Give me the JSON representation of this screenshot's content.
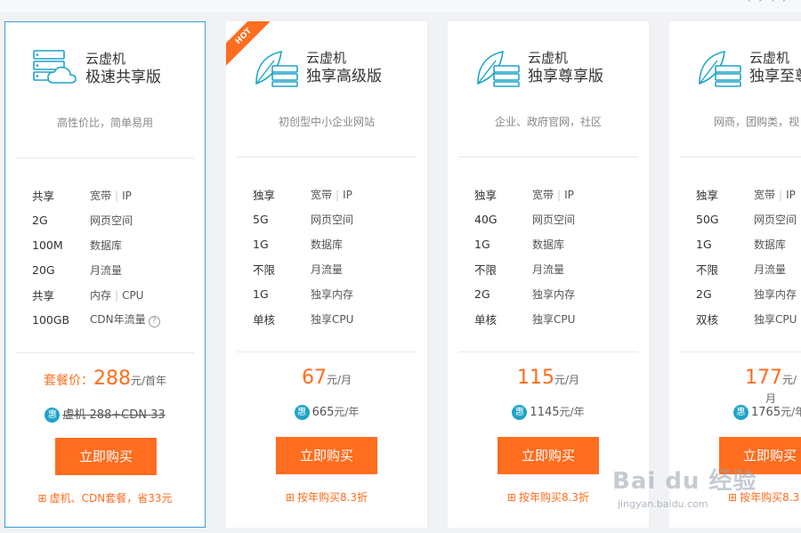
{
  "cards": [
    {
      "title1": "云虚机",
      "title2": "极速共享版",
      "subtitle": "高性价比，简单易用",
      "hot": "",
      "specs": [
        {
          "value": "共享",
          "label": "宽带",
          "label2": "IP"
        },
        {
          "value": "2G",
          "label": "网页空间"
        },
        {
          "value": "100M",
          "label": "数据库"
        },
        {
          "value": "20G",
          "label": "月流量"
        },
        {
          "value": "共享",
          "label": "内存",
          "label2": "CPU"
        },
        {
          "value": "100GB",
          "label": "CDN年流量",
          "help": "?"
        }
      ],
      "price_prefix": "套餐价：",
      "price": "288",
      "price_unit": "元/首年",
      "badge": "惠",
      "sub_price": "虚机 288+CDN 33",
      "buy_label": "立即购买",
      "note": "虚机、CDN套餐，省33元"
    },
    {
      "title1": "云虚机",
      "title2": "独享高级版",
      "subtitle": "初创型中小企业网站",
      "hot": "HOT",
      "specs": [
        {
          "value": "独享",
          "label": "宽带",
          "label2": "IP"
        },
        {
          "value": "5G",
          "label": "网页空间"
        },
        {
          "value": "1G",
          "label": "数据库"
        },
        {
          "value": "不限",
          "label": "月流量"
        },
        {
          "value": "1G",
          "label": "独享内存"
        },
        {
          "value": "单核",
          "label": "独享CPU"
        }
      ],
      "price": "67",
      "price_unit": "元/月",
      "badge": "惠",
      "sub_price": "665",
      "sub_unit": "元/年",
      "buy_label": "立即购买",
      "note": "按年购买8.3折"
    },
    {
      "title1": "云虚机",
      "title2": "独享尊享版",
      "subtitle": "企业、政府官网，社区",
      "hot": "",
      "specs": [
        {
          "value": "独享",
          "label": "宽带",
          "label2": "IP"
        },
        {
          "value": "40G",
          "label": "网页空间"
        },
        {
          "value": "1G",
          "label": "数据库"
        },
        {
          "value": "不限",
          "label": "月流量"
        },
        {
          "value": "2G",
          "label": "独享内存"
        },
        {
          "value": "单核",
          "label": "独享CPU"
        }
      ],
      "price": "115",
      "price_unit": "元/月",
      "badge": "惠",
      "sub_price": "1145",
      "sub_unit": "元/年",
      "buy_label": "立即购买",
      "note": "按年购买8.3折"
    },
    {
      "title1": "云虚机",
      "title2": "独享至尊",
      "subtitle": "网商，团购类，视",
      "hot": "",
      "specs": [
        {
          "value": "独享",
          "label": "宽带",
          "label2": "IP"
        },
        {
          "value": "50G",
          "label": "网页空间"
        },
        {
          "value": "1G",
          "label": "数据库"
        },
        {
          "value": "不限",
          "label": "月流量"
        },
        {
          "value": "2G",
          "label": "独享内存"
        },
        {
          "value": "双核",
          "label": "独享CPU"
        }
      ],
      "price": "177",
      "price_unit": "元/月",
      "badge": "惠",
      "sub_price": "1765",
      "sub_unit": "元/年",
      "buy_label": "立即购买",
      "note": "按年购买8.3"
    }
  ],
  "watermark": {
    "line1": "Bai du 经验",
    "line2": "jingyan.baidu.com"
  },
  "colors": {
    "accent": "#ff6d1f",
    "active_border": "#3b9bd6",
    "icon": "#1fa4c9"
  }
}
